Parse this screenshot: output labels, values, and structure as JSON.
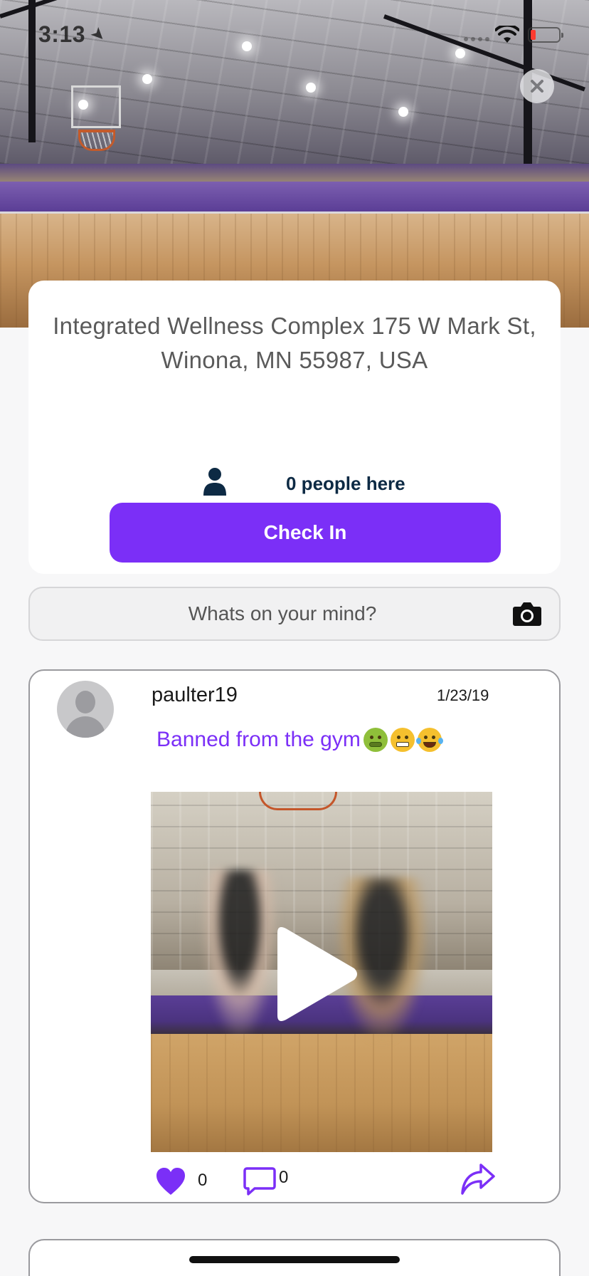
{
  "status_bar": {
    "time": "3:13"
  },
  "location": {
    "address": "Integrated Wellness Complex 175 W Mark St, Winona, MN 55987, USA",
    "people_count": "0 people here",
    "checkin_label": "Check In"
  },
  "compose": {
    "placeholder": "Whats on your mind?"
  },
  "post": {
    "username": "paulter19",
    "date": "1/23/19",
    "text": "Banned from the gym",
    "emojis": [
      "nauseated-face",
      "grimacing-face",
      "tears-of-joy-face"
    ],
    "likes": "0",
    "comments": "0"
  },
  "colors": {
    "accent": "#7b2ff7",
    "people_text": "#0d2a44"
  }
}
